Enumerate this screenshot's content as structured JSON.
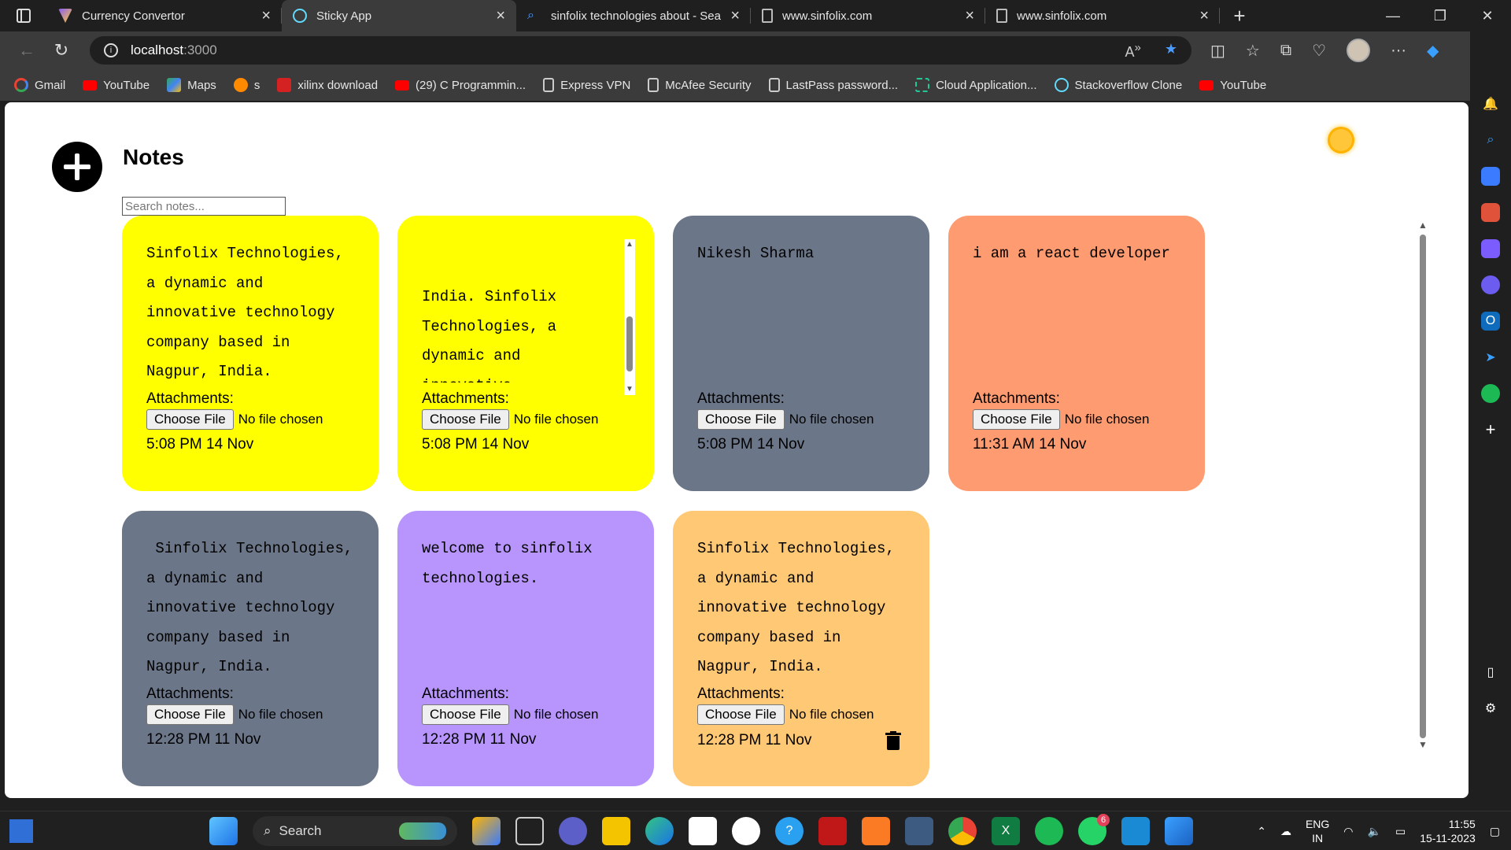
{
  "browser": {
    "tabs": [
      {
        "label": "Currency Convertor",
        "favicon": "vite-icon",
        "color": "#8b5cf6",
        "active": false
      },
      {
        "label": "Sticky App",
        "favicon": "react-icon",
        "color": "#61dafb",
        "active": true
      },
      {
        "label": "sinfolix technologies about - Sea",
        "favicon": "search-icon",
        "color": "#4c9bff",
        "active": false
      },
      {
        "label": "www.sinfolix.com",
        "favicon": "page-icon",
        "color": "#bbbbbb",
        "active": false
      },
      {
        "label": "www.sinfolix.com",
        "favicon": "page-icon",
        "color": "#bbbbbb",
        "active": false
      }
    ],
    "address": {
      "host": "localhost",
      "port": ":3000"
    },
    "bookmarks": [
      {
        "label": "Gmail",
        "icon": "google-icon",
        "color": "#ea4335"
      },
      {
        "label": "YouTube",
        "icon": "youtube-icon",
        "color": "#ff0000"
      },
      {
        "label": "Maps",
        "icon": "maps-icon",
        "color": "#34a853"
      },
      {
        "label": "s",
        "icon": "hand-icon",
        "color": "#ff8a00"
      },
      {
        "label": "xilinx download",
        "icon": "xilinx-icon",
        "color": "#d42222"
      },
      {
        "label": "(29) C Programmin...",
        "icon": "youtube-icon",
        "color": "#ff0000"
      },
      {
        "label": "Express VPN",
        "icon": "page-icon",
        "color": "#3b3b3b"
      },
      {
        "label": "McAfee Security",
        "icon": "page-icon",
        "color": "#3b3b3b"
      },
      {
        "label": "LastPass password...",
        "icon": "page-icon",
        "color": "#3b3b3b"
      },
      {
        "label": "Cloud Application...",
        "icon": "cloud-app-icon",
        "color": "#20c997"
      },
      {
        "label": "Stackoverflow Clone",
        "icon": "react-icon",
        "color": "#61dafb"
      },
      {
        "label": "YouTube",
        "icon": "youtube-icon",
        "color": "#ff0000"
      }
    ]
  },
  "app": {
    "title": "Notes",
    "search_placeholder": "Search notes...",
    "attachments_label": "Attachments:",
    "choose_file_label": "Choose File",
    "no_file_label": "No file chosen",
    "notes": [
      {
        "text": "Sinfolix Technologies,\na dynamic and\ninnovative technology\ncompany based in\nNagpur, India.",
        "time": "5:08 PM 14 Nov",
        "color": "#ffff00"
      },
      {
        "text": "India. Sinfolix\nTechnologies, a\ndynamic and innovative\ntechnology company\nbased in Nagpur,\nIndia.",
        "time": "5:08 PM 14 Nov",
        "color": "#ffff00"
      },
      {
        "text": "Nikesh Sharma",
        "time": "5:08 PM 14 Nov",
        "color": "#6b7688"
      },
      {
        "text": "i am a react developer",
        "time": "11:31 AM 14 Nov",
        "color": "#ff9b70"
      },
      {
        "text": " Sinfolix Technologies,\na dynamic and\ninnovative technology\ncompany based in\nNagpur, India.",
        "time": "12:28 PM 11 Nov",
        "color": "#6b7688"
      },
      {
        "text": "welcome to sinfolix\ntechnologies.",
        "time": "12:28 PM 11 Nov",
        "color": "#b795fc"
      },
      {
        "text": "Sinfolix Technologies,\na dynamic and\ninnovative technology\ncompany based in\nNagpur, India.",
        "time": "12:28 PM 11 Nov",
        "color": "#ffc875"
      }
    ]
  },
  "taskbar": {
    "search_label": "Search",
    "lang": "ENG",
    "region": "IN",
    "time": "11:55",
    "date": "15-11-2023",
    "whatsapp_badge": "6"
  }
}
